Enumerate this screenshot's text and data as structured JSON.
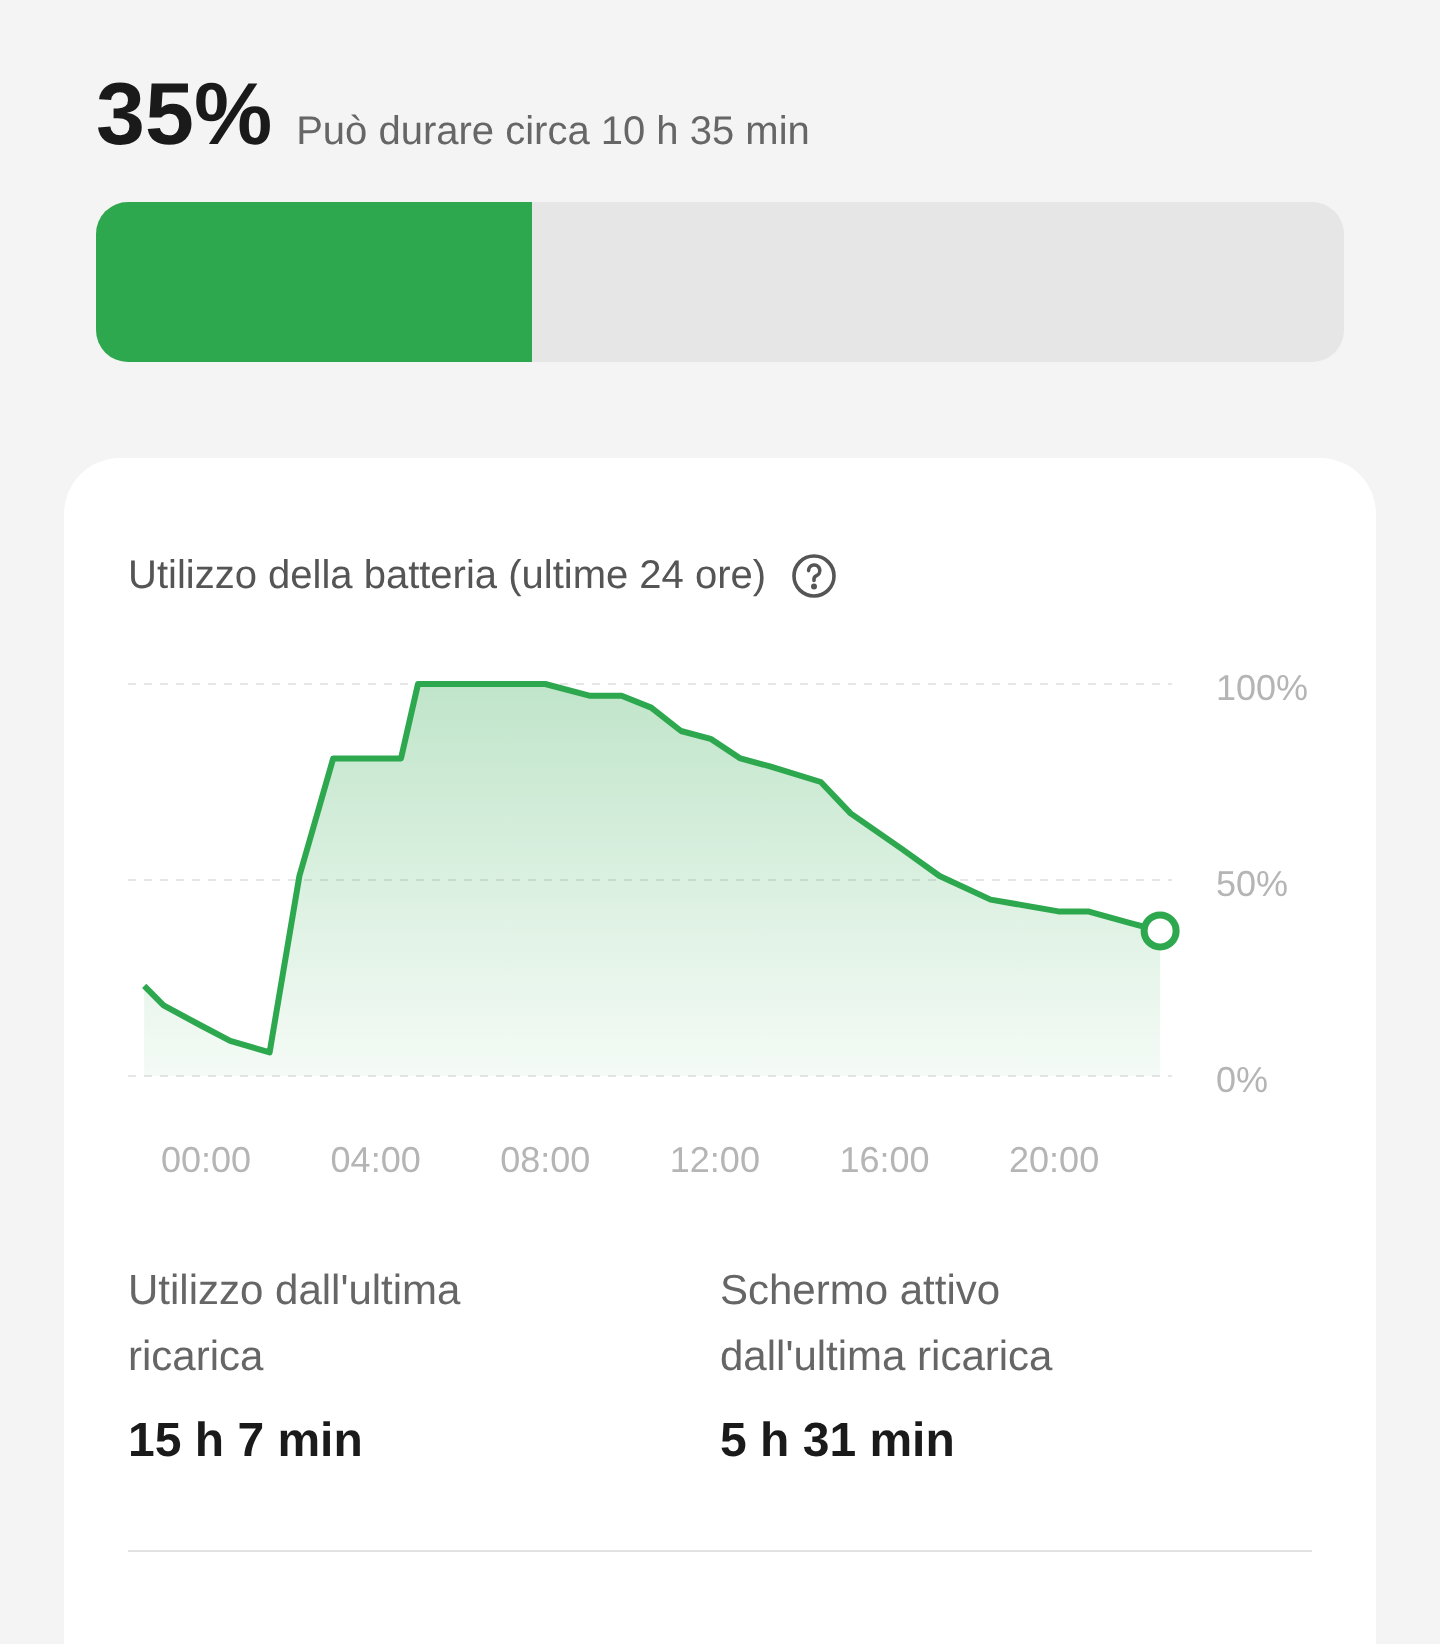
{
  "battery": {
    "percent": "35%",
    "estimate": "Può durare circa 10 h 35 min",
    "level": 0.35
  },
  "usage_card": {
    "title": "Utilizzo della batteria (ultime 24 ore)",
    "chart_data": {
      "type": "area",
      "x": [
        -1.46,
        -1.0,
        -0.14,
        0.57,
        1.5,
        2.2,
        3.0,
        4.6,
        5.0,
        8.0,
        9.06,
        9.8,
        10.5,
        11.2,
        11.9,
        12.6,
        13.3,
        14.5,
        15.2,
        16.4,
        17.3,
        18.5,
        20.1,
        20.8,
        21.8,
        22.5
      ],
      "series": [
        {
          "color": "#2ea84e",
          "values": [
            23,
            18,
            13,
            9,
            6,
            51,
            81,
            81,
            100,
            100,
            97,
            97,
            94,
            88,
            86,
            81,
            79,
            75,
            67,
            58,
            51,
            45,
            42,
            42,
            39,
            37
          ]
        }
      ],
      "xlim": [
        -1.84,
        22.78
      ],
      "ylim": [
        0,
        100
      ],
      "yticks": [
        {
          "value": 0,
          "label": "0%"
        },
        {
          "value": 50,
          "label": "50%"
        },
        {
          "value": 100,
          "label": "100%"
        }
      ],
      "xticks": [
        {
          "value": 0,
          "label": "00:00"
        },
        {
          "value": 4,
          "label": "04:00"
        },
        {
          "value": 8,
          "label": "08:00"
        },
        {
          "value": 12,
          "label": "12:00"
        },
        {
          "value": 16,
          "label": "16:00"
        },
        {
          "value": 20,
          "label": "20:00"
        }
      ]
    },
    "stats": [
      {
        "label": "Utilizzo dall'ultima ricarica",
        "value": "15 h 7 min"
      },
      {
        "label": "Schermo attivo dall'ultima ricarica",
        "value": "5 h 31 min"
      }
    ]
  }
}
